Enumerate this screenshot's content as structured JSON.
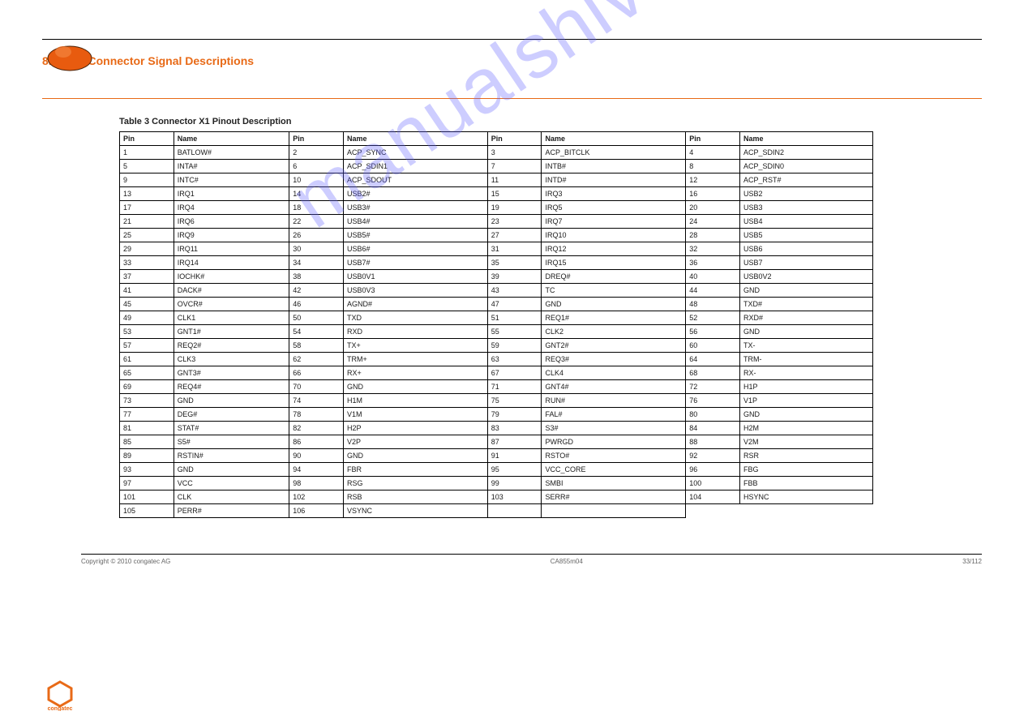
{
  "section": {
    "num": "8.2",
    "title": "X1 Connector Signal Descriptions"
  },
  "table_title": "Table 3   Connector X1 Pinout Description",
  "headers": [
    "Pin",
    "Name",
    "Pin",
    "Name",
    "Pin",
    "Name",
    "Pin",
    "Name"
  ],
  "rows": [
    [
      "1",
      "BATLOW#",
      "2",
      "ACP_SYNC",
      "3",
      "ACP_BITCLK",
      "4",
      "ACP_SDIN2"
    ],
    [
      "5",
      "INTA#",
      "6",
      "ACP_SDIN1",
      "7",
      "INTB#",
      "8",
      "ACP_SDIN0"
    ],
    [
      "9",
      "INTC#",
      "10",
      "ACP_SDOUT",
      "11",
      "INTD#",
      "12",
      "ACP_RST#"
    ],
    [
      "13",
      "IRQ1",
      "14",
      "USB2#",
      "15",
      "IRQ3",
      "16",
      "USB2"
    ],
    [
      "17",
      "IRQ4",
      "18",
      "USB3#",
      "19",
      "IRQ5",
      "20",
      "USB3"
    ],
    [
      "21",
      "IRQ6",
      "22",
      "USB4#",
      "23",
      "IRQ7",
      "24",
      "USB4"
    ],
    [
      "25",
      "IRQ9",
      "26",
      "USB5#",
      "27",
      "IRQ10",
      "28",
      "USB5"
    ],
    [
      "29",
      "IRQ11",
      "30",
      "USB6#",
      "31",
      "IRQ12",
      "32",
      "USB6"
    ],
    [
      "33",
      "IRQ14",
      "34",
      "USB7#",
      "35",
      "IRQ15",
      "36",
      "USB7"
    ],
    [
      "37",
      "IOCHK#",
      "38",
      "USB0V1",
      "39",
      "DREQ#",
      "40",
      "USB0V2"
    ],
    [
      "41",
      "DACK#",
      "42",
      "USB0V3",
      "43",
      "TC",
      "44",
      "GND"
    ],
    [
      "45",
      "OVCR#",
      "46",
      "AGND#",
      "47",
      "GND",
      "48",
      "TXD#"
    ],
    [
      "49",
      "CLK1",
      "50",
      "TXD",
      "51",
      "REQ1#",
      "52",
      "RXD#"
    ],
    [
      "53",
      "GNT1#",
      "54",
      "RXD",
      "55",
      "CLK2",
      "56",
      "GND"
    ],
    [
      "57",
      "REQ2#",
      "58",
      "TX+",
      "59",
      "GNT2#",
      "60",
      "TX-"
    ],
    [
      "61",
      "CLK3",
      "62",
      "TRM+",
      "63",
      "REQ3#",
      "64",
      "TRM-"
    ],
    [
      "65",
      "GNT3#",
      "66",
      "RX+",
      "67",
      "CLK4",
      "68",
      "RX-"
    ],
    [
      "69",
      "REQ4#",
      "70",
      "GND",
      "71",
      "GNT4#",
      "72",
      "H1P"
    ],
    [
      "73",
      "GND",
      "74",
      "H1M",
      "75",
      "RUN#",
      "76",
      "V1P"
    ],
    [
      "77",
      "DEG#",
      "78",
      "V1M",
      "79",
      "FAL#",
      "80",
      "GND"
    ],
    [
      "81",
      "STAT#",
      "82",
      "H2P",
      "83",
      "S3#",
      "84",
      "H2M"
    ],
    [
      "85",
      "S5#",
      "86",
      "V2P",
      "87",
      "PWRGD",
      "88",
      "V2M"
    ],
    [
      "89",
      "RSTIN#",
      "90",
      "GND",
      "91",
      "RSTO#",
      "92",
      "RSR"
    ],
    [
      "93",
      "GND",
      "94",
      "FBR",
      "95",
      "VCC_CORE",
      "96",
      "FBG"
    ],
    [
      "97",
      "VCC",
      "98",
      "RSG",
      "99",
      "SMBI",
      "100",
      "FBB"
    ],
    [
      "101",
      "CLK",
      "102",
      "RSB",
      "103",
      "SERR#",
      "104",
      "HSYNC"
    ],
    [
      "105",
      "PERR#",
      "106",
      "VSYNC",
      " ",
      " "
    ]
  ],
  "footer": {
    "left": "Copyright © 2010 congatec AG",
    "center": "CA855m04",
    "right": "33/112"
  },
  "watermark": "manualshive.com"
}
